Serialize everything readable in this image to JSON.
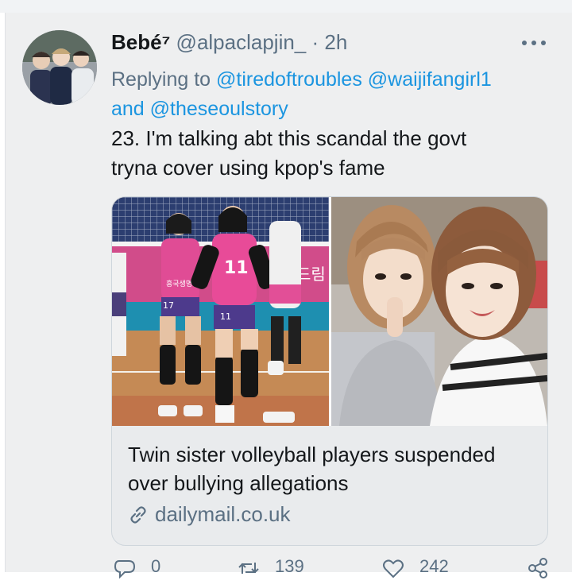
{
  "tweet": {
    "author_name": "Bebé⁷",
    "author_handle": "@alpaclapjin_",
    "separator": "·",
    "time": "2h",
    "reply_prefix": "Replying to",
    "reply_mention_1": "@tiredoftroubles",
    "reply_mention_2": "@waijifangirl1",
    "reply_and": "and",
    "reply_mention_3": "@theseoulstory",
    "text_line_1": "23. I'm talking abt this scandal the govt",
    "text_line_2": "tryna cover using kpop's fame"
  },
  "card": {
    "title": "Twin sister volleyball players suspended over bullying allegations",
    "domain": "dailymail.co.uk",
    "jersey_number": "11",
    "jersey_number_2": "17",
    "banner_text": "드림"
  },
  "actions": {
    "reply_count": "0",
    "retweet_count": "139",
    "like_count": "242"
  },
  "icons": [
    "more-icon",
    "link-icon",
    "reply-icon",
    "retweet-icon",
    "like-icon",
    "share-icon"
  ],
  "colors": {
    "accent": "#1b95e0",
    "secondary_text": "#5b7083",
    "background": "#eeeff0"
  }
}
